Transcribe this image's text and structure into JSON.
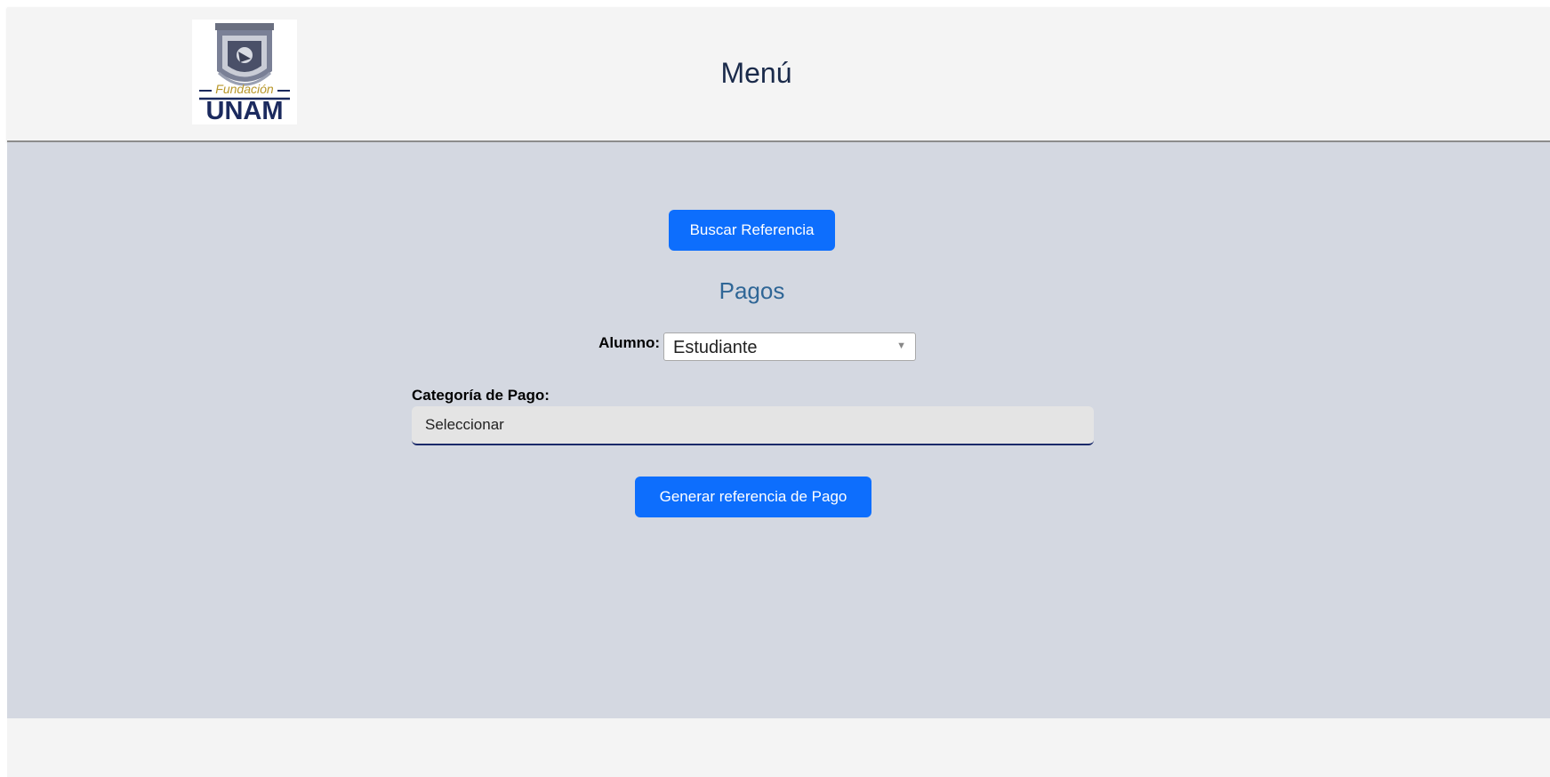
{
  "header": {
    "logo": {
      "icon": "unam-crest-icon",
      "top_text": "Fundación",
      "bottom_text": "UNAM"
    },
    "title": "Menú"
  },
  "main": {
    "search_button_label": "Buscar Referencia",
    "section_title": "Pagos",
    "student": {
      "label": "Alumno:",
      "selected": "Estudiante"
    },
    "category": {
      "label": "Categoría de Pago:",
      "selected": "Seleccionar"
    },
    "generate_button_label": "Generar referencia de Pago"
  },
  "colors": {
    "header_bg": "#f4f4f4",
    "main_bg": "#d4d8e1",
    "button_primary": "#0d6efd",
    "section_title": "#2f6696",
    "logo_navy": "#1b2a5e",
    "logo_gold": "#b8972b"
  }
}
